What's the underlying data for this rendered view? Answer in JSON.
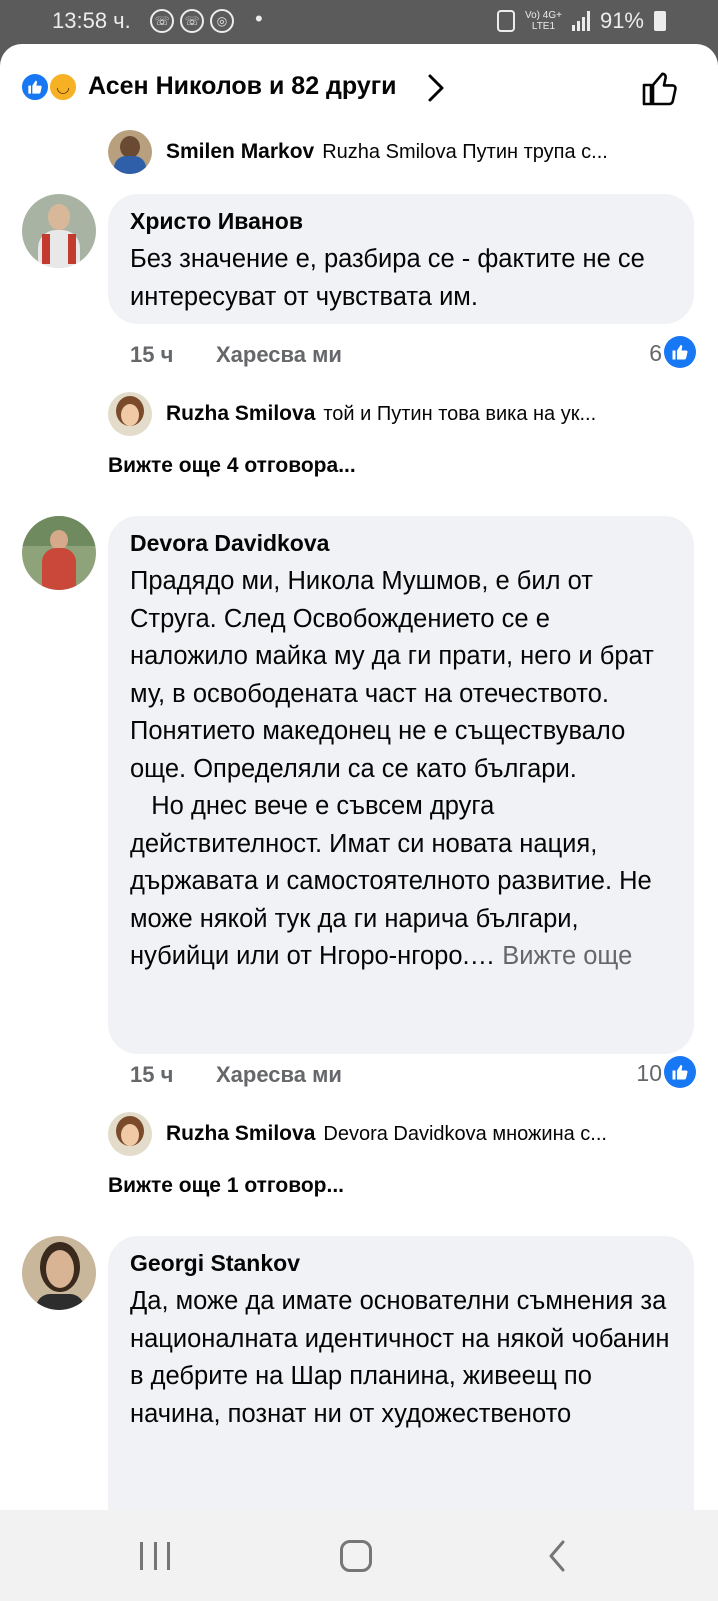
{
  "status_bar": {
    "time": "13:58 ч.",
    "network": [
      "Vo) 4G+",
      "LTE1"
    ],
    "battery": "91%"
  },
  "header": {
    "title": "Асен Николов и 82 други",
    "reaction_icons": [
      "like-icon",
      "haha-icon"
    ]
  },
  "comments": [
    {
      "type": "reply_preview",
      "name": "Smilen Markov",
      "snippet": "Ruzha Smilova Путин трупа с..."
    },
    {
      "type": "comment",
      "author": "Христо Иванов",
      "text": "Без значение е, разбира се - фактите не се интересуват от чувствата им.",
      "time": "15 ч",
      "like_label": "Харесва ми",
      "like_count": "6"
    },
    {
      "type": "reply_preview",
      "name": "Ruzha Smilova",
      "snippet": "той и Путин това вика на ук..."
    },
    {
      "type": "more_replies",
      "label": "Вижте още 4 отговора..."
    },
    {
      "type": "comment",
      "author": "Devora Davidkova",
      "text": "Прадядо ми, Никола Мушмов, е бил от Струга. След Освобождението се е наложило майка му да ги прати, него и брат му, в освободената част на отечеството. Понятието македонец не е съществувало още. Определяли са се като българи.\n   Но днес вече е съвсем друга действителност. Имат си новата нация, държавата и самостоятелното развитие. Не може някой тук да ги нарича българи, нубийци или от Нгоро-нгоро.…",
      "see_more": "Вижте още",
      "time": "15 ч",
      "like_label": "Харесва ми",
      "like_count": "10"
    },
    {
      "type": "reply_preview",
      "name": "Ruzha Smilova",
      "snippet": "Devora Davidkova множина с..."
    },
    {
      "type": "more_replies",
      "label": "Вижте още 1 отговор..."
    },
    {
      "type": "comment",
      "author": "Georgi Stankov",
      "text": "Да, може да имате основателни съмнения за националната идентичност на някой чобанин в дебрите на Шар планина, живеещ по начина, познат ни от художественото"
    }
  ],
  "colors": {
    "accent": "#1877f2",
    "bubble": "#f0f2f5",
    "secondary_text": "#65676b"
  }
}
